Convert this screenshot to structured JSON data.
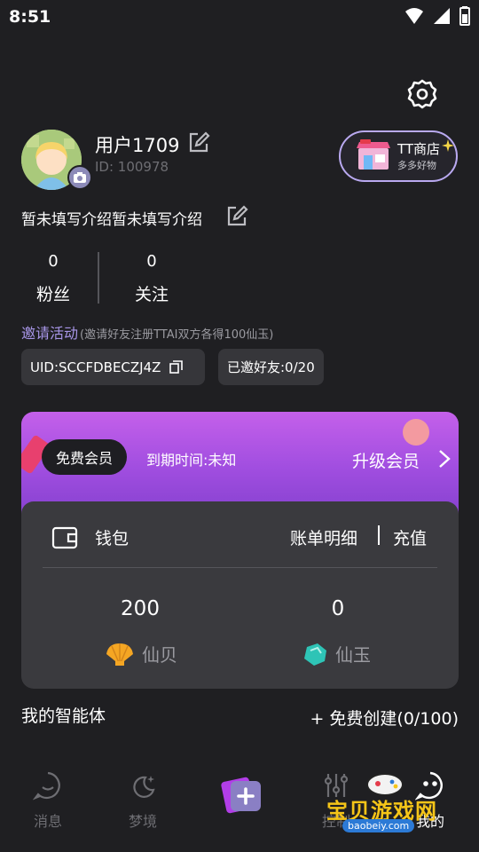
{
  "status_bar": {
    "time": "8:51"
  },
  "profile": {
    "username": "用户1709",
    "user_id": "ID: 100978",
    "intro": "暂未填写介绍暂未填写介绍"
  },
  "tt_store": {
    "title": "TT商店",
    "subtitle": "多多好物"
  },
  "stats": [
    {
      "value": "0",
      "label": "粉丝"
    },
    {
      "value": "0",
      "label": "关注"
    }
  ],
  "invite": {
    "title": "邀请活动",
    "description": "(邀请好友注册TTAI双方各得100仙玉)",
    "uid_chip": "UID:SCCFDBECZJ4Z",
    "invited_chip": "已邀好友:0/20"
  },
  "vip": {
    "badge": "免费会员",
    "expire": "到期时间:未知",
    "upgrade": "升级会员"
  },
  "wallet": {
    "title": "钱包",
    "bill": "账单明细",
    "recharge": "充值",
    "balances": [
      {
        "value": "200",
        "currency": "仙贝"
      },
      {
        "value": "0",
        "currency": "仙玉"
      }
    ]
  },
  "agents": {
    "title": "我的智能体",
    "create": "+ 免费创建(0/100)"
  },
  "tabbar": [
    {
      "label": "消息"
    },
    {
      "label": "梦境"
    },
    {
      "label": "控制"
    },
    {
      "label": "我的"
    }
  ],
  "watermark": {
    "brand": "宝贝游戏网",
    "url": "baobeiy.com"
  },
  "colors": {
    "background": "#1f1f22",
    "accent": "#a896e8",
    "vip_gradient_top": "#c460ea",
    "wallet_card": "#3a3a3e"
  }
}
